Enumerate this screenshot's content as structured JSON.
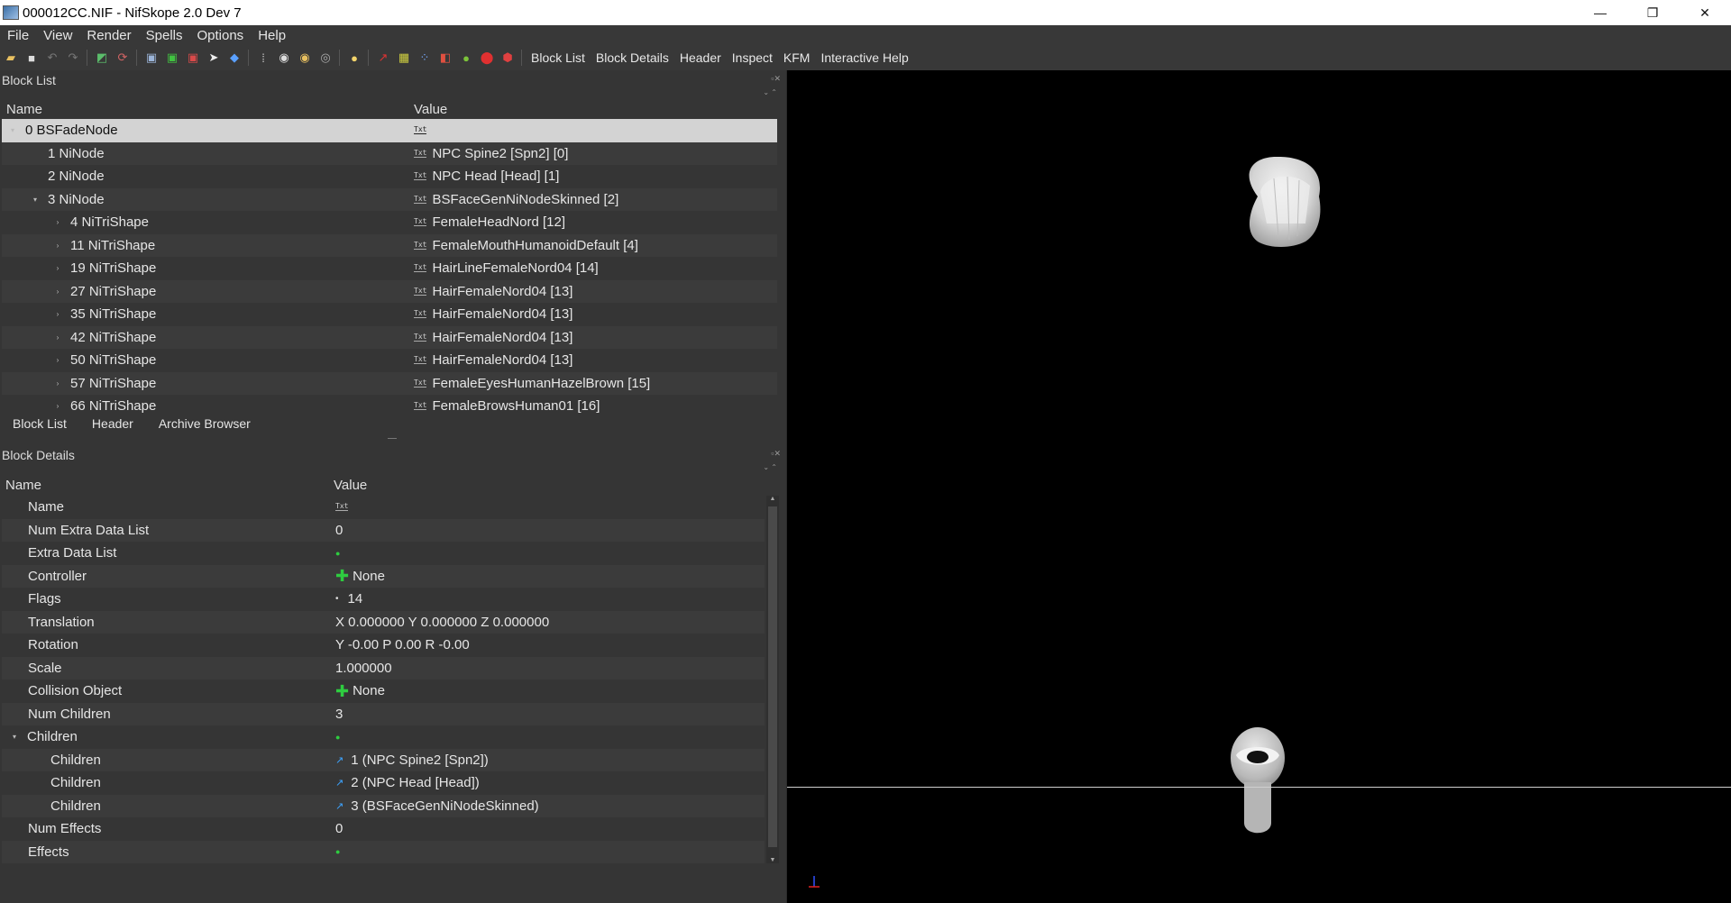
{
  "window": {
    "title": "000012CC.NIF - NifSkope 2.0 Dev 7",
    "controls": [
      "—",
      "❐",
      "✕"
    ]
  },
  "menu": [
    "File",
    "View",
    "Render",
    "Spells",
    "Options",
    "Help"
  ],
  "toolbar": {
    "text_buttons": [
      "Block List",
      "Block Details",
      "Header",
      "Inspect",
      "KFM",
      "Interactive Help"
    ]
  },
  "block_list": {
    "title": "Block List",
    "headers": {
      "name": "Name",
      "value": "Value"
    },
    "rows": [
      {
        "name": "0 BSFadeNode",
        "value": "",
        "indent": 0,
        "exp": "▾",
        "icon": "Txt"
      },
      {
        "name": "1 NiNode",
        "value": "NPC Spine2 [Spn2] [0]",
        "indent": 1,
        "exp": "",
        "icon": "Txt"
      },
      {
        "name": "2 NiNode",
        "value": "NPC Head [Head] [1]",
        "indent": 1,
        "exp": "",
        "icon": "Txt"
      },
      {
        "name": "3 NiNode",
        "value": "BSFaceGenNiNodeSkinned [2]",
        "indent": 1,
        "exp": "▾",
        "icon": "Txt"
      },
      {
        "name": "4 NiTriShape",
        "value": "FemaleHeadNord [12]",
        "indent": 2,
        "exp": "›",
        "icon": "Txt"
      },
      {
        "name": "11 NiTriShape",
        "value": "FemaleMouthHumanoidDefault [4]",
        "indent": 2,
        "exp": "›",
        "icon": "Txt"
      },
      {
        "name": "19 NiTriShape",
        "value": "HairLineFemaleNord04 [14]",
        "indent": 2,
        "exp": "›",
        "icon": "Txt"
      },
      {
        "name": "27 NiTriShape",
        "value": "HairFemaleNord04 [13]",
        "indent": 2,
        "exp": "›",
        "icon": "Txt"
      },
      {
        "name": "35 NiTriShape",
        "value": "HairFemaleNord04 [13]",
        "indent": 2,
        "exp": "›",
        "icon": "Txt"
      },
      {
        "name": "42 NiTriShape",
        "value": "HairFemaleNord04 [13]",
        "indent": 2,
        "exp": "›",
        "icon": "Txt"
      },
      {
        "name": "50 NiTriShape",
        "value": "HairFemaleNord04 [13]",
        "indent": 2,
        "exp": "›",
        "icon": "Txt"
      },
      {
        "name": "57 NiTriShape",
        "value": "FemaleEyesHumanHazelBrown [15]",
        "indent": 2,
        "exp": "›",
        "icon": "Txt"
      },
      {
        "name": "66 NiTriShape",
        "value": "FemaleBrowsHuman01 [16]",
        "indent": 2,
        "exp": "›",
        "icon": "Txt"
      }
    ]
  },
  "tabs": [
    "Block List",
    "Header",
    "Archive Browser"
  ],
  "block_details": {
    "title": "Block Details",
    "headers": {
      "name": "Name",
      "value": "Value"
    },
    "rows": [
      {
        "name": "Name",
        "value": "",
        "indent": 1,
        "exp": "",
        "marker": "txt"
      },
      {
        "name": "Num Extra Data List",
        "value": "0",
        "indent": 1,
        "exp": "",
        "marker": ""
      },
      {
        "name": "Extra Data List",
        "value": "",
        "indent": 1,
        "exp": "",
        "marker": "dot"
      },
      {
        "name": "Controller",
        "value": "None",
        "indent": 1,
        "exp": "",
        "marker": "plus"
      },
      {
        "name": "Flags",
        "value": "14",
        "indent": 1,
        "exp": "",
        "marker": "flag"
      },
      {
        "name": "Translation",
        "value": "X 0.000000 Y 0.000000 Z 0.000000",
        "indent": 1,
        "exp": "",
        "marker": ""
      },
      {
        "name": "Rotation",
        "value": "Y -0.00 P 0.00 R -0.00",
        "indent": 1,
        "exp": "",
        "marker": ""
      },
      {
        "name": "Scale",
        "value": "1.000000",
        "indent": 1,
        "exp": "",
        "marker": ""
      },
      {
        "name": "Collision Object",
        "value": "None",
        "indent": 1,
        "exp": "",
        "marker": "plus"
      },
      {
        "name": "Num Children",
        "value": "3",
        "indent": 1,
        "exp": "",
        "marker": ""
      },
      {
        "name": "Children",
        "value": "",
        "indent": 0,
        "exp": "▾",
        "marker": "dot"
      },
      {
        "name": "Children",
        "value": "1 (NPC Spine2 [Spn2])",
        "indent": 2,
        "exp": "",
        "marker": "link"
      },
      {
        "name": "Children",
        "value": "2 (NPC Head [Head])",
        "indent": 2,
        "exp": "",
        "marker": "link"
      },
      {
        "name": "Children",
        "value": "3 (BSFaceGenNiNodeSkinned)",
        "indent": 2,
        "exp": "",
        "marker": "link"
      },
      {
        "name": "Num Effects",
        "value": "0",
        "indent": 1,
        "exp": "",
        "marker": ""
      },
      {
        "name": "Effects",
        "value": "",
        "indent": 1,
        "exp": "",
        "marker": "dot"
      }
    ]
  },
  "colors": {
    "background": "#2b2b2b",
    "selected_row": "#d3d3d3",
    "viewport": "#000000",
    "accent_green": "#2ecc40"
  }
}
